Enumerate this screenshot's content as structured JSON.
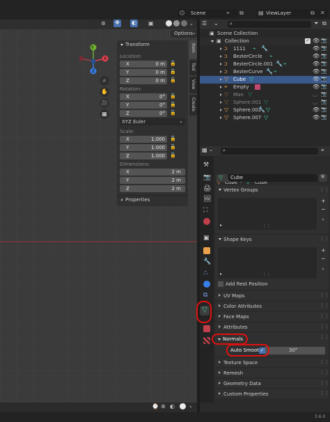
{
  "topbar": {
    "scene_label": "Scene",
    "viewlayer_label": "ViewLayer"
  },
  "viewport": {
    "options_label": "Options",
    "gizmo": {
      "x": "X",
      "y": "Y",
      "z": "Z"
    }
  },
  "npanel": {
    "transform_title": "Transform",
    "location_label": "Location:",
    "rotation_label": "Rotation:",
    "scale_label": "Scale:",
    "dimensions_label": "Dimensions:",
    "rotation_mode": "XYZ Euler",
    "properties_title": "Properties",
    "location": [
      {
        "axis": "X",
        "value": "0 m"
      },
      {
        "axis": "Y",
        "value": "0 m"
      },
      {
        "axis": "Z",
        "value": "0 m"
      }
    ],
    "rotation": [
      {
        "axis": "X",
        "value": "0°"
      },
      {
        "axis": "Y",
        "value": "0°"
      },
      {
        "axis": "Z",
        "value": "0°"
      }
    ],
    "scale": [
      {
        "axis": "X",
        "value": "1.000"
      },
      {
        "axis": "Y",
        "value": "1.000"
      },
      {
        "axis": "Z",
        "value": "1.000"
      }
    ],
    "dimensions": [
      {
        "axis": "X",
        "value": "2 m"
      },
      {
        "axis": "Y",
        "value": "2 m"
      },
      {
        "axis": "Z",
        "value": "2 m"
      }
    ],
    "tabs": [
      "Item",
      "Tool",
      "View",
      "Create"
    ]
  },
  "outliner": {
    "scene_collection": "Scene Collection",
    "collection": "Collection",
    "items": [
      {
        "name": "1111"
      },
      {
        "name": "BezierCircle"
      },
      {
        "name": "BezierCircle.001"
      },
      {
        "name": "BezierCurve"
      },
      {
        "name": "Cube"
      },
      {
        "name": "Empty"
      },
      {
        "name": "Man"
      },
      {
        "name": "Sphere.001"
      },
      {
        "name": "Sphere.002"
      },
      {
        "name": "Sphere.007"
      }
    ]
  },
  "properties": {
    "object_name": "Cube",
    "mesh_name_path": "Cube",
    "mesh_name": "Cube",
    "vertex_groups": "Vertex Groups",
    "shape_keys": "Shape Keys",
    "add_rest_position": "Add Rest Position",
    "uv_maps": "UV Maps",
    "color_attributes": "Color Attributes",
    "face_maps": "Face Maps",
    "attributes": "Attributes",
    "normals": "Normals",
    "auto_smooth": "Auto Smooth",
    "auto_smooth_angle": "30°",
    "texture_space": "Texture Space",
    "remesh": "Remesh",
    "geometry_data": "Geometry Data",
    "custom_properties": "Custom Properties"
  },
  "statusbar": {
    "version": "3.6.0"
  },
  "colors": {
    "highlight_red": "#e01010",
    "selection_blue": "#3a5a8c",
    "mesh_green": "#3fd69a",
    "axis_x": "#e04050",
    "axis_y": "#70b030",
    "axis_z": "#3a7ee8"
  }
}
